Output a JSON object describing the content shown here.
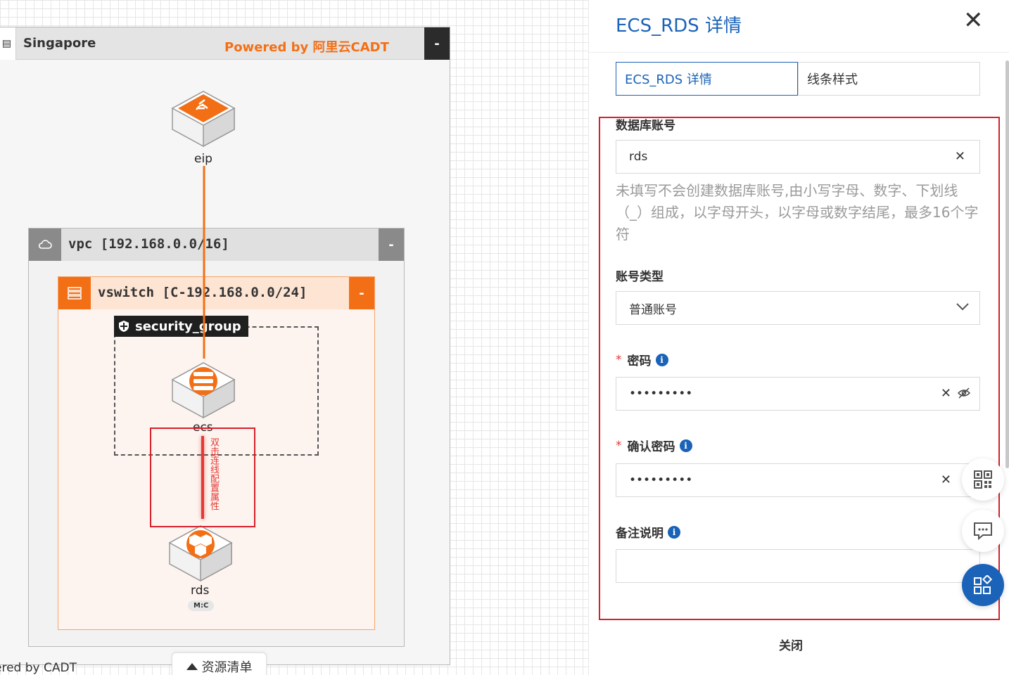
{
  "canvas": {
    "region": {
      "title": "Singapore",
      "powered": "Powered by 阿里云CADT",
      "collapse": "-"
    },
    "vpc": {
      "title": "vpc [192.168.0.0/16]",
      "collapse": "-"
    },
    "vswitch": {
      "title": "vswitch [C-192.168.0.0/24]",
      "collapse": "-"
    },
    "security_group": {
      "label": "security_group"
    },
    "nodes": {
      "eip": "eip",
      "ecs": "ecs",
      "rds": "rds",
      "rds_badge": "M:C"
    },
    "line_hint": "双击连线配置属性",
    "bottom_powered": "ered by CADT",
    "resource_list": "资源清单"
  },
  "panel": {
    "title": "ECS_RDS 详情",
    "tabs": [
      {
        "label": "ECS_RDS 详情",
        "active": true
      },
      {
        "label": "线条样式",
        "active": false
      }
    ],
    "fields": {
      "db_account": {
        "label": "数据库账号",
        "value": "rds"
      },
      "hint": "未填写不会创建数据库账号,由小写字母、数字、下划线（_）组成，以字母开头，以字母或数字结尾，最多16个字符",
      "account_type": {
        "label": "账号类型",
        "value": "普通账号"
      },
      "password": {
        "label": "密码",
        "value": "•••••••••"
      },
      "confirm_password": {
        "label": "确认密码",
        "value": "•••••••••"
      },
      "remark": {
        "label": "备注说明",
        "value": ""
      }
    },
    "close_label": "关闭"
  },
  "colors": {
    "accent_blue": "#1a63b8",
    "orange": "#f36f16",
    "highlight_red": "#d6202a"
  }
}
